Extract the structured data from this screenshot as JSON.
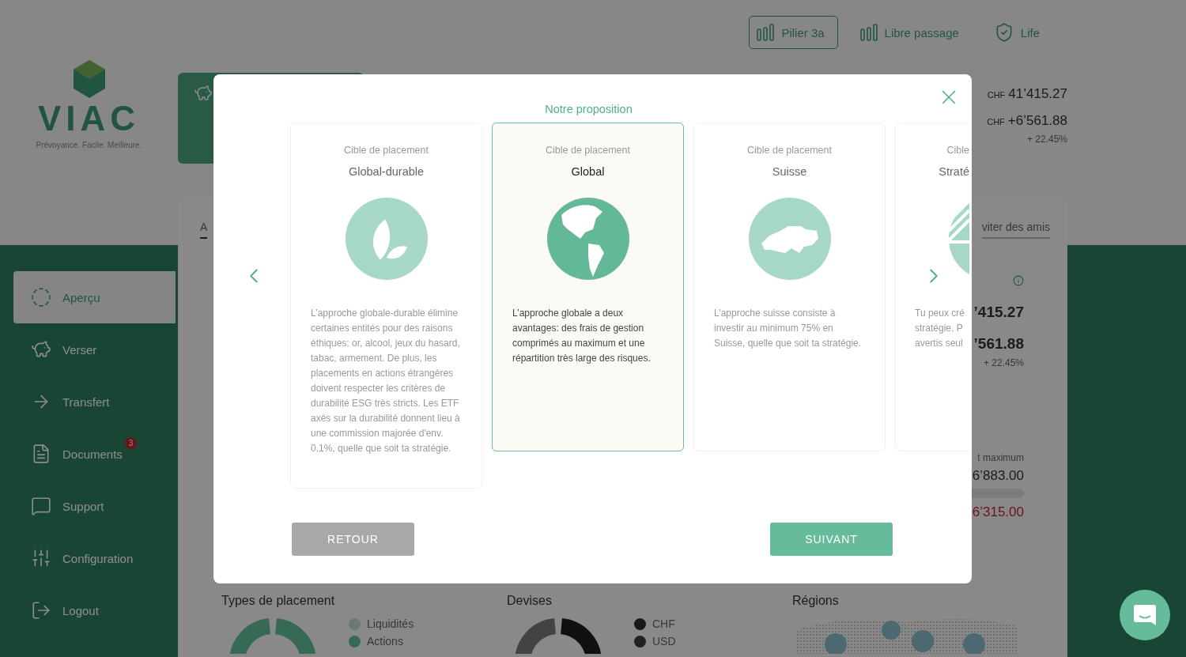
{
  "logo": {
    "name": "VIAC",
    "tagline": "Prévoyance. Facile. Meilleure."
  },
  "product_tabs": [
    {
      "label": "Pilier 3a",
      "selected": true
    },
    {
      "label": "Libre passage",
      "selected": false
    },
    {
      "label": "Life",
      "selected": false
    }
  ],
  "sidebar": {
    "items": [
      {
        "label": "Aperçu",
        "selected": true
      },
      {
        "label": "Verser",
        "selected": false
      },
      {
        "label": "Transfert",
        "selected": false
      },
      {
        "label": "Documents",
        "selected": false,
        "badge": "3"
      },
      {
        "label": "Support",
        "selected": false
      },
      {
        "label": "Configuration",
        "selected": false
      },
      {
        "label": "Logout",
        "selected": false
      }
    ]
  },
  "summary": {
    "total": {
      "currency": "CHF",
      "amount": "41’415.27"
    },
    "gain": {
      "currency": "CHF",
      "amount": "+6’561.88"
    },
    "gain_percent": "+ 22.45%"
  },
  "panel": {
    "tabs": [
      {
        "label": "A",
        "selected": true
      },
      {
        "label": "viter des amis",
        "selected": false
      }
    ],
    "stats": [
      {
        "kind": "info"
      },
      {
        "kind": "amount",
        "text": "’415.27"
      },
      {
        "kind": "amount",
        "text": "’561.88"
      },
      {
        "kind": "note",
        "text": "+ 22.45%"
      },
      {
        "kind": "caption",
        "text": "t maximum"
      },
      {
        "kind": "value",
        "text": "6’883.00"
      },
      {
        "kind": "bar"
      },
      {
        "kind": "negative",
        "text": "6’315.00"
      }
    ],
    "sections": [
      {
        "title": "Types de placement",
        "legend": [
          "Liquidités",
          "Actions"
        ]
      },
      {
        "title": "Devises",
        "legend": [
          "CHF",
          "USD"
        ]
      },
      {
        "title": "Régions"
      }
    ]
  },
  "modal": {
    "title": "Notre proposition",
    "cards": [
      {
        "kind": "full",
        "selected": false,
        "label": "Cible de placement",
        "name": "Global-durable",
        "description": "L’approche globale-durable élimine certaines entités pour des raisons éthiques: or, alcool, jeux du hasard, tabac, armement. De plus, les placements en actions étrangères doivent respecter les critères de durabilité ESG très stricts. Les ETF axés sur la durabilité donnent lieu à une commission majorée d'env. 0.1%, quelle que soit ta stratégie."
      },
      {
        "kind": "full",
        "selected": true,
        "label": "Cible de placement",
        "name": "Global",
        "description": "L’approche globale a deux avantages: des frais de gestion comprimés au maximum et une répartition très large des risques."
      },
      {
        "kind": "full",
        "selected": false,
        "label": "Cible de placement",
        "name": "Suisse",
        "description": "L’approche suisse consiste à investir au minimum 75% en Suisse, quelle que soit ta stratégie."
      },
      {
        "kind": "partial",
        "selected": false,
        "label": "Cible",
        "name": "Straté",
        "description": "Tu peux cré\nstratégie. P\navertis seul"
      }
    ],
    "buttons": [
      {
        "label": "RETOUR",
        "disabled": true
      },
      {
        "label": "SUIVANT",
        "disabled": false
      }
    ]
  }
}
